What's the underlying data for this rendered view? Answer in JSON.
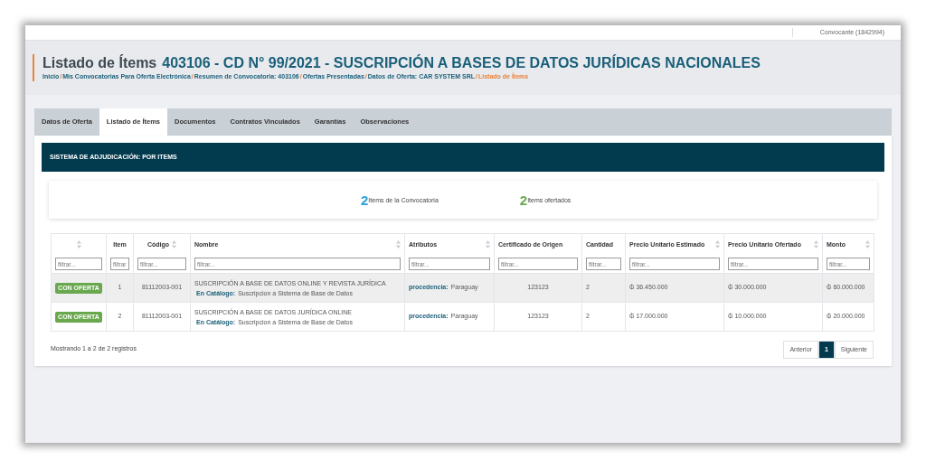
{
  "top_bar": {
    "user_role": "Convocante (1842994)"
  },
  "header": {
    "title_prefix": "Listado de Ítems",
    "title_main": "403106 - CD N° 99/2021 - SUSCRIPCIÓN A BASES DE DATOS JURÍDICAS NACIONALES",
    "breadcrumb": {
      "separator": "/",
      "items": [
        {
          "label": "Inicio",
          "selected": false
        },
        {
          "label": "Mis Convocatorias Para Oferta Electrónica",
          "selected": false
        },
        {
          "label": "Resumen de Convocatoria: 403106",
          "selected": false
        },
        {
          "label": "Ofertas Presentadas",
          "selected": false
        },
        {
          "label": "Datos de Oferta: CAR SYSTEM SRL",
          "selected": false
        },
        {
          "label": "Listado de Ítems",
          "selected": true
        }
      ]
    }
  },
  "tabs": [
    {
      "label": "Datos de Oferta",
      "selected": false
    },
    {
      "label": "Listado de Ítems",
      "selected": true
    },
    {
      "label": "Documentos",
      "selected": false
    },
    {
      "label": "Contratos Vinculados",
      "selected": false
    },
    {
      "label": "Garantías",
      "selected": false
    },
    {
      "label": "Observaciones",
      "selected": false
    }
  ],
  "panel_title": "SISTEMA DE ADJUDICACIÓN: POR ITEMS",
  "stats": [
    {
      "value": "2",
      "label": "Items de la Convocatoria",
      "color": "#2a9fd8"
    },
    {
      "value": "2",
      "label": "Items ofertados",
      "color": "#6aa84f"
    }
  ],
  "table": {
    "columns": [
      {
        "sortable": true
      },
      {
        "label": "Item",
        "sortable": false
      },
      {
        "label": "Código",
        "sortable": true
      },
      {
        "label": "Nombre",
        "sortable": true
      },
      {
        "label": "Atributos",
        "sortable": true
      },
      {
        "label": "Certificado de Origen",
        "sortable": false
      },
      {
        "label": "Cantidad",
        "sortable": false
      },
      {
        "label": "Precio Unitario Estimado",
        "sortable": true
      },
      {
        "label": "Precio Unitario Ofertado",
        "sortable": true
      },
      {
        "label": "Monto",
        "sortable": true
      }
    ],
    "filter_placeholders": [
      "filtrar...",
      "filtrar",
      "filtrar...",
      "filtrar...",
      "filtrar...",
      "filtrar...",
      "filtrar...",
      "filtrar...",
      "filtrar...",
      "filtrar..."
    ],
    "rows": [
      {
        "status": "CON OFERTA",
        "item": "1",
        "code": "81112003-001",
        "name": "SUSCRIPCIÓN A BASE DE DATOS ONLINE Y REVISTA JURÍDICA",
        "catalog_label": "En Catálogo:",
        "catalog_value": "Suscripcion a Sistema de Base de Datos",
        "attribute_label": "procedencia:",
        "attribute_value": "Paraguay",
        "certificate": "123123",
        "quantity": "2",
        "estimated_price": "₲ 36.450.000",
        "offered_price": "₲ 30.000.000",
        "amount": "₲ 60.000.000",
        "selected": true
      },
      {
        "status": "CON OFERTA",
        "item": "2",
        "code": "81112003-001",
        "name": "SUSCRIPCIÓN A BASE DE DATOS JURÍDICA ONLINE",
        "catalog_label": "En Catálogo:",
        "catalog_value": "Suscripcion a Sistema de Base de Datos",
        "attribute_label": "procedencia:",
        "attribute_value": "Paraguay",
        "certificate": "123123",
        "quantity": "2",
        "estimated_price": "₲ 17.000.000",
        "offered_price": "₲ 10.000.000",
        "amount": "₲ 20.000.000",
        "selected": false
      }
    ]
  },
  "footer": {
    "summary": "Mostrando 1 a 2 de 2 registros",
    "pagination": [
      {
        "label": "Anterior",
        "selected": false
      },
      {
        "label": "1",
        "selected": true
      },
      {
        "label": "Siguiente",
        "selected": false
      }
    ]
  }
}
